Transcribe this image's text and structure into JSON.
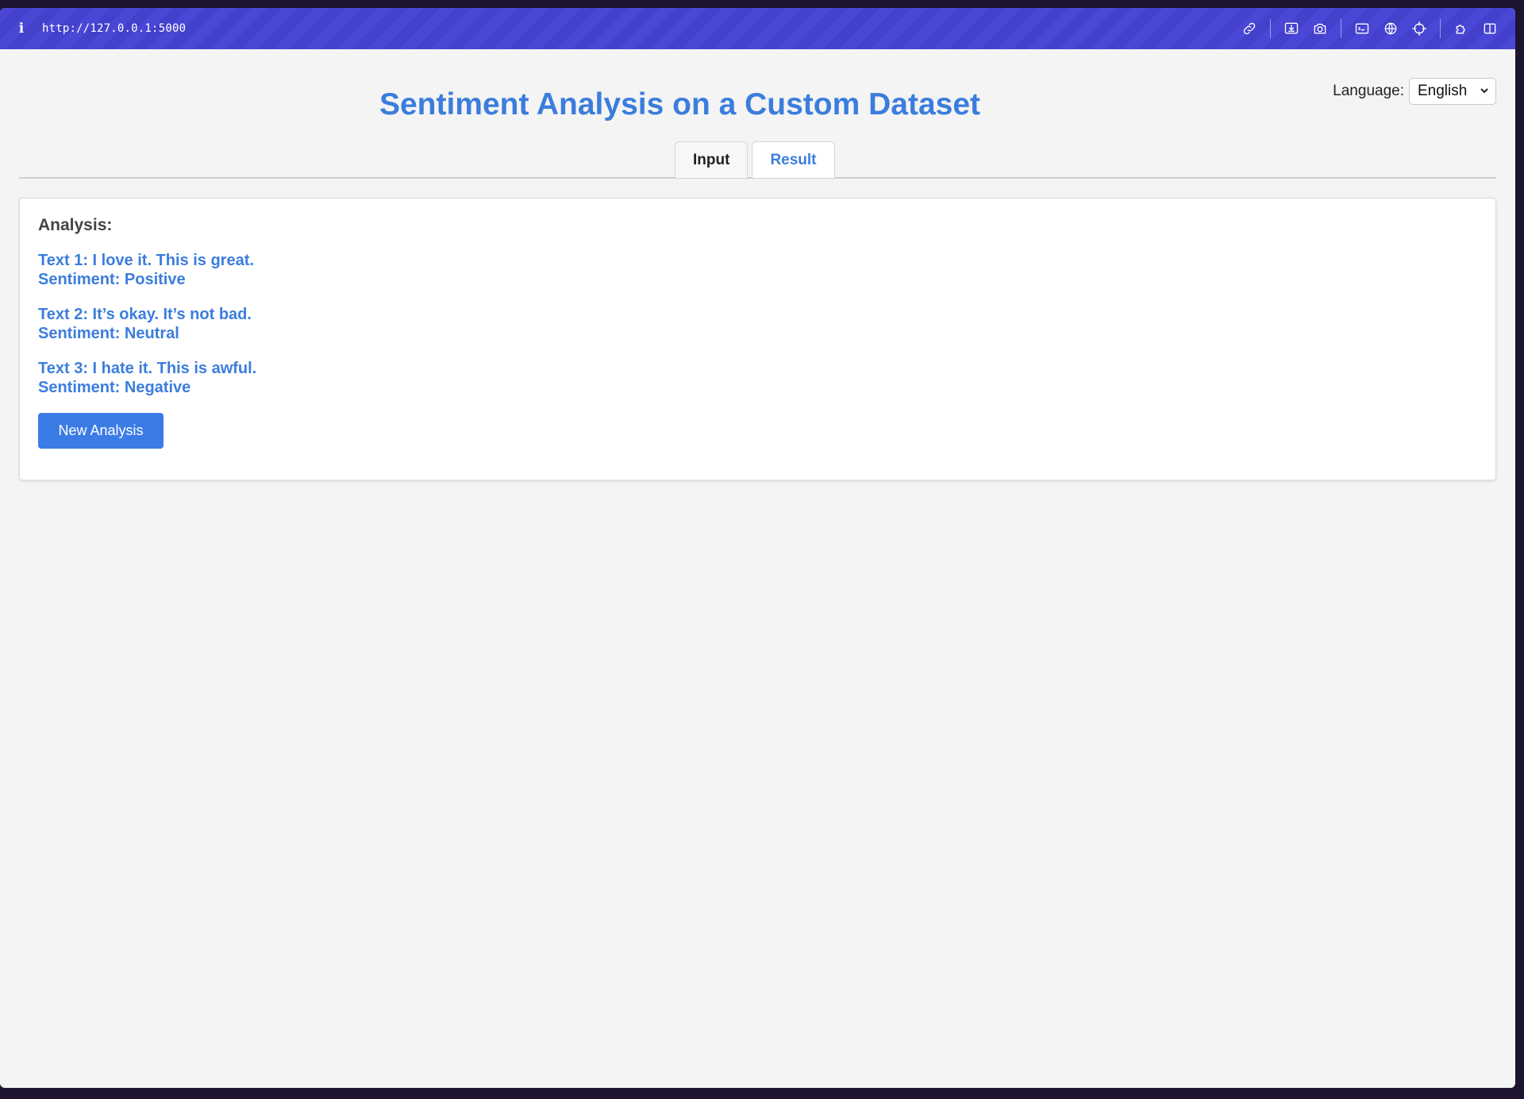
{
  "browser": {
    "url": "http://127.0.0.1:5000",
    "info_glyph": "i",
    "icons": [
      "link-icon",
      "download-icon",
      "camera-icon",
      "terminal-icon",
      "globe-icon",
      "crosshair-icon",
      "extensions-icon",
      "sidebar-icon"
    ]
  },
  "header": {
    "title": "Sentiment Analysis on a Custom Dataset",
    "language_label": "Language:",
    "language_selected": "English"
  },
  "tabs": [
    {
      "label": "Input",
      "active": false
    },
    {
      "label": "Result",
      "active": true
    }
  ],
  "result": {
    "heading": "Analysis:",
    "items": [
      {
        "text": "Text 1: I love it. This is great.",
        "sentiment": "Sentiment: Positive"
      },
      {
        "text": "Text 2: It’s okay. It’s not bad.",
        "sentiment": "Sentiment: Neutral"
      },
      {
        "text": "Text 3: I hate it. This is awful.",
        "sentiment": "Sentiment: Negative"
      }
    ],
    "button_label": "New Analysis"
  },
  "colors": {
    "accent": "#3b7ddd",
    "button": "#3b7be6",
    "toolbar": "#4a47d6",
    "background": "#f4f4f4"
  }
}
